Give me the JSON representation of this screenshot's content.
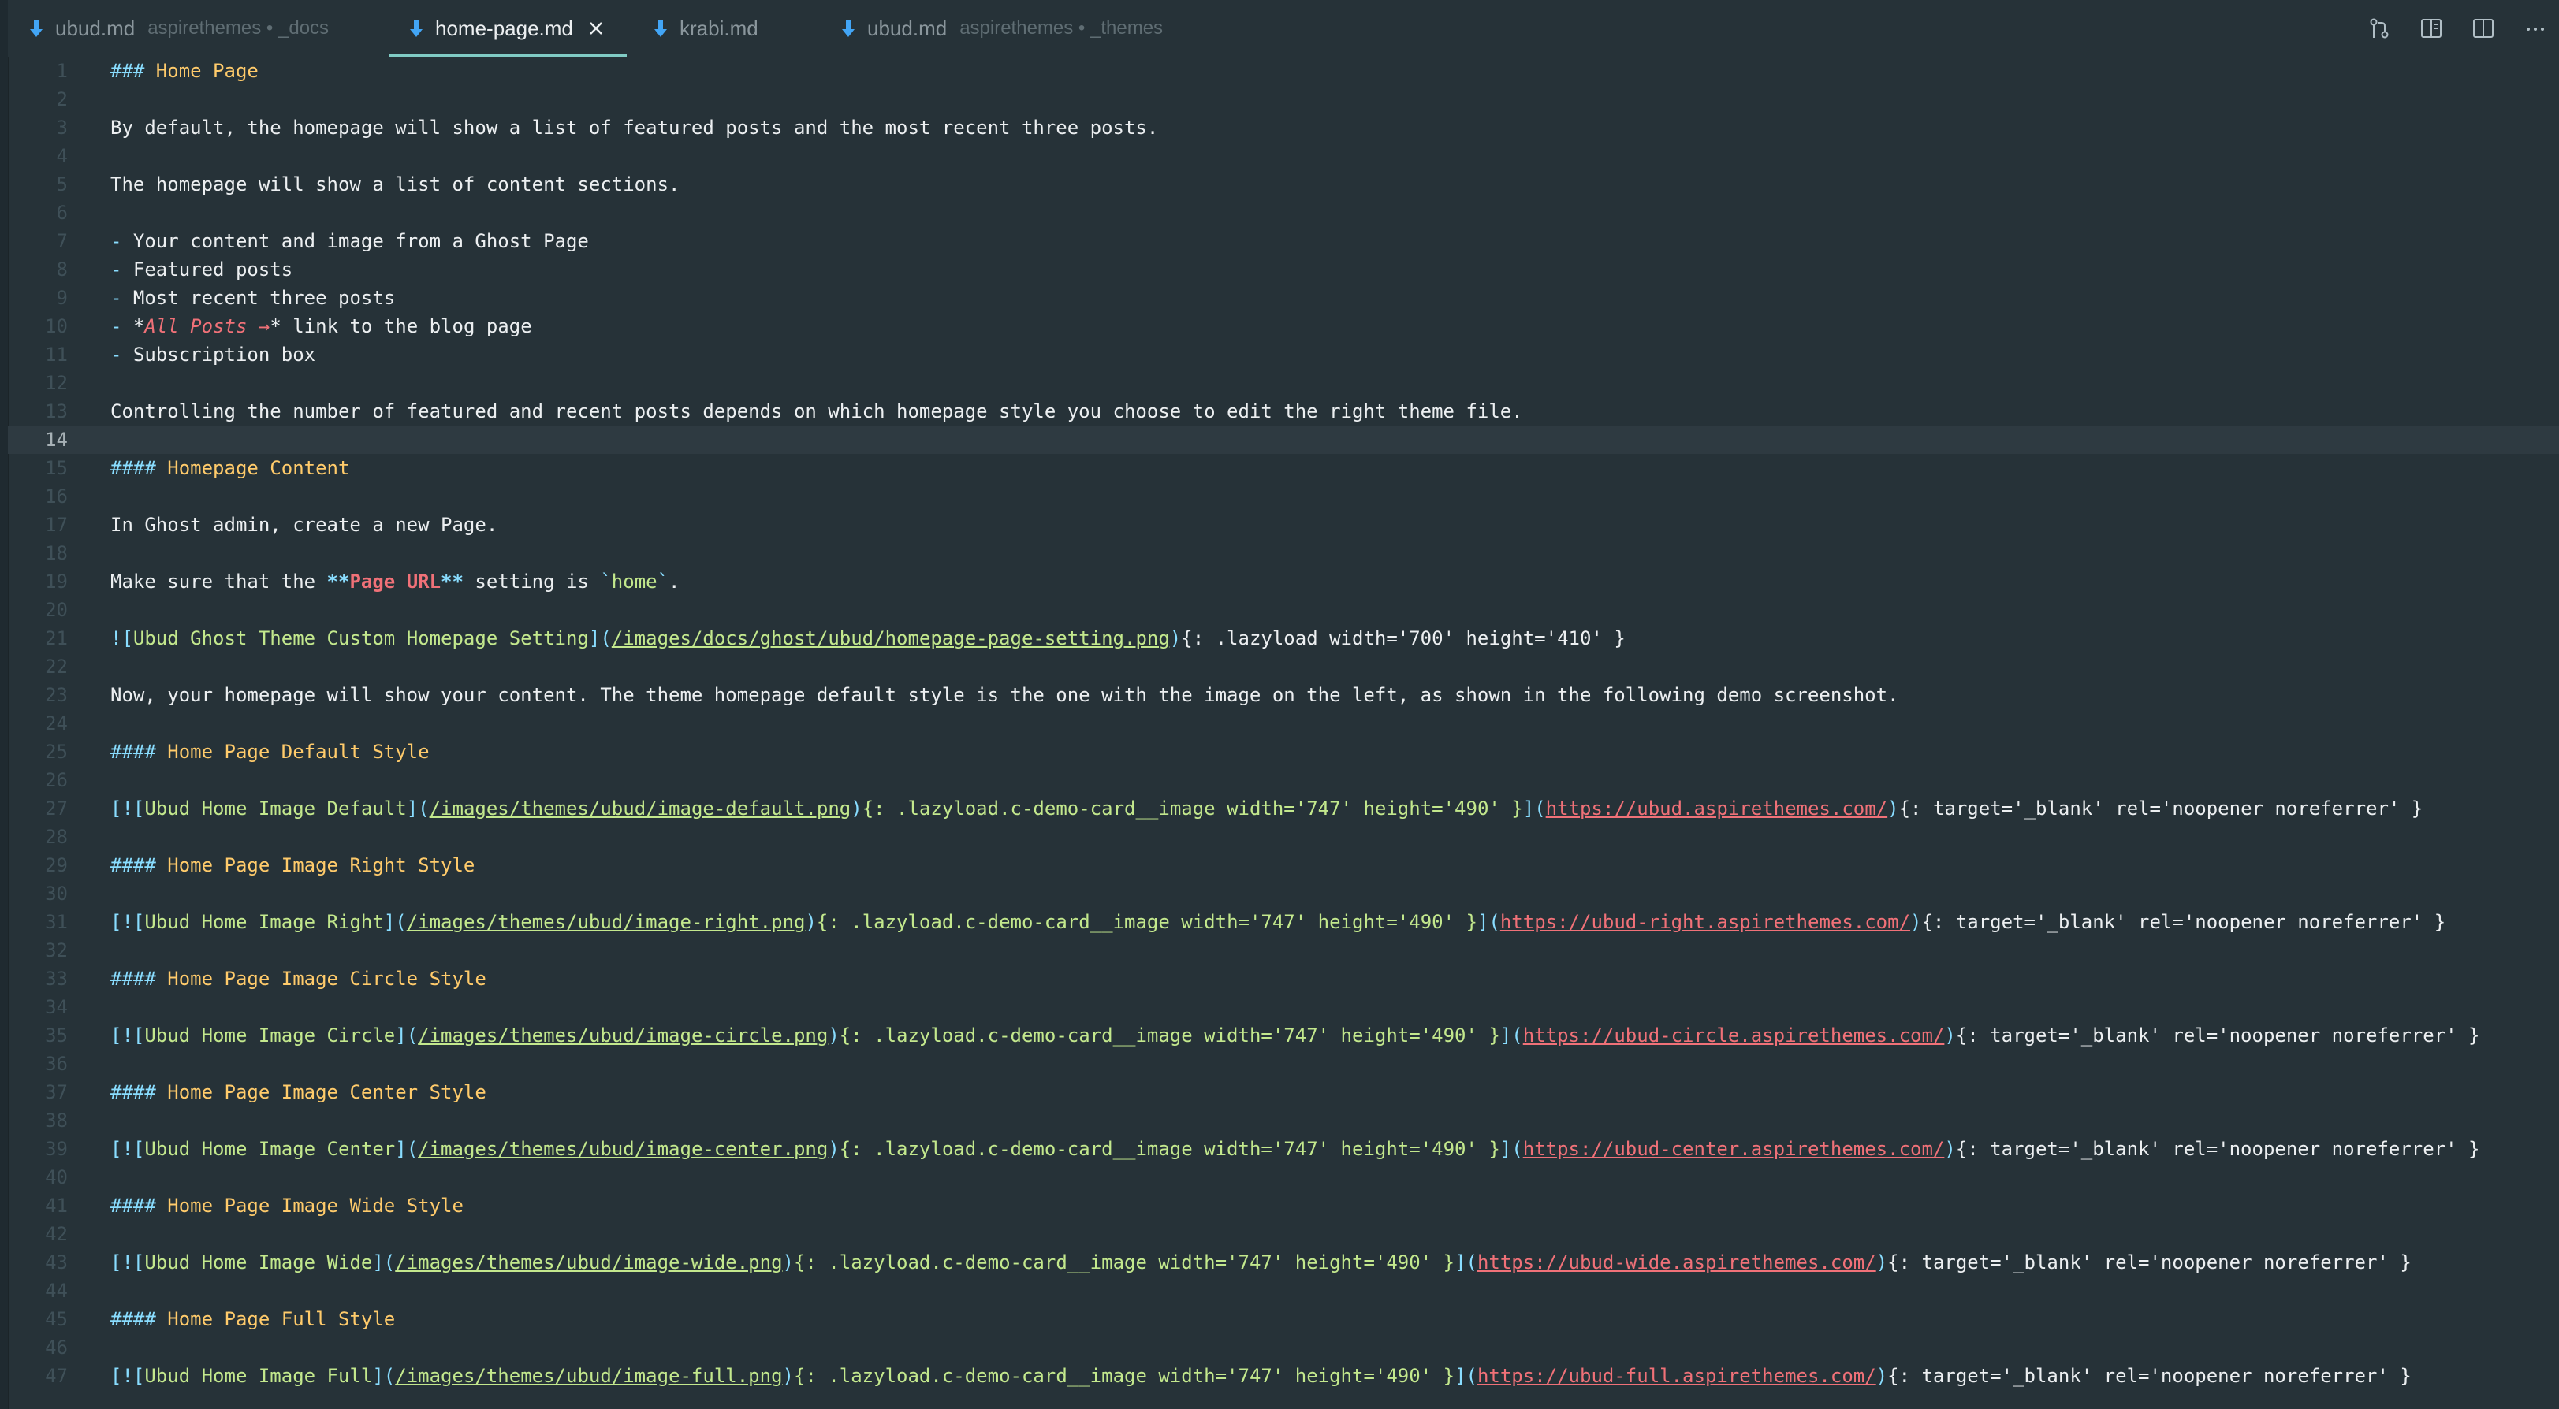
{
  "tabs": [
    {
      "icon": "markdown-file-icon",
      "name": "ubud.md",
      "description": "aspirethemes • _docs",
      "active": false
    },
    {
      "icon": "markdown-file-icon",
      "name": "home-page.md",
      "description": "",
      "active": true
    },
    {
      "icon": "markdown-file-icon",
      "name": "krabi.md",
      "description": "",
      "active": false
    },
    {
      "icon": "markdown-file-icon",
      "name": "ubud.md",
      "description": "aspirethemes • _themes",
      "active": false
    }
  ],
  "toolbar_icons": [
    "source-control-icon",
    "open-preview-icon",
    "split-editor-icon",
    "more-actions-icon"
  ],
  "editor": {
    "current_line": 14,
    "lines": [
      {
        "n": "1",
        "parts": [
          [
            "hm",
            "### "
          ],
          [
            "h",
            "Home Page"
          ]
        ]
      },
      {
        "n": "2",
        "parts": []
      },
      {
        "n": "3",
        "parts": [
          [
            "t",
            "By default, the homepage will show a list of featured posts and the most recent three posts."
          ]
        ]
      },
      {
        "n": "4",
        "parts": []
      },
      {
        "n": "5",
        "parts": [
          [
            "t",
            "The homepage will show a list of content sections."
          ]
        ]
      },
      {
        "n": "6",
        "parts": []
      },
      {
        "n": "7",
        "parts": [
          [
            "pl",
            "- "
          ],
          [
            "t",
            "Your content and image from a Ghost Page"
          ]
        ]
      },
      {
        "n": "8",
        "parts": [
          [
            "pl",
            "- "
          ],
          [
            "t",
            "Featured posts"
          ]
        ]
      },
      {
        "n": "9",
        "parts": [
          [
            "pl",
            "- "
          ],
          [
            "t",
            "Most recent three posts"
          ]
        ]
      },
      {
        "n": "10",
        "parts": [
          [
            "pl",
            "- "
          ],
          [
            "t",
            "*"
          ],
          [
            "em",
            "All Posts →"
          ],
          [
            "t",
            "*"
          ],
          [
            "t",
            " link to the blog page"
          ]
        ]
      },
      {
        "n": "11",
        "parts": [
          [
            "pl",
            "- "
          ],
          [
            "t",
            "Subscription box"
          ]
        ]
      },
      {
        "n": "12",
        "parts": []
      },
      {
        "n": "13",
        "parts": [
          [
            "t",
            "Controlling the number of featured and recent posts depends on which homepage style you choose to edit the right theme file."
          ]
        ]
      },
      {
        "n": "14",
        "parts": []
      },
      {
        "n": "15",
        "parts": [
          [
            "hm",
            "#### "
          ],
          [
            "h",
            "Homepage Content"
          ]
        ]
      },
      {
        "n": "16",
        "parts": []
      },
      {
        "n": "17",
        "parts": [
          [
            "t",
            "In Ghost admin, create a new Page."
          ]
        ]
      },
      {
        "n": "18",
        "parts": []
      },
      {
        "n": "19",
        "parts": [
          [
            "t",
            "Make sure that the "
          ],
          [
            "stm",
            "**"
          ],
          [
            "st",
            "Page URL"
          ],
          [
            "stm",
            "**"
          ],
          [
            "t",
            " setting is "
          ],
          [
            "cdm",
            "`"
          ],
          [
            "cd",
            "home"
          ],
          [
            "cdm",
            "`"
          ],
          [
            "t",
            "."
          ]
        ]
      },
      {
        "n": "20",
        "parts": []
      },
      {
        "n": "21",
        "parts": [
          [
            "punc",
            "!["
          ],
          [
            "alt",
            "Ubud Ghost Theme Custom Homepage Setting"
          ],
          [
            "punc",
            "]("
          ],
          [
            "path",
            "/images/docs/ghost/ubud/homepage-page-setting.png"
          ],
          [
            "punc",
            ")"
          ],
          [
            "attrw",
            "{: .lazyload width='700' height='410' }"
          ]
        ]
      },
      {
        "n": "22",
        "parts": []
      },
      {
        "n": "23",
        "parts": [
          [
            "t",
            "Now, your homepage will show your content. The theme homepage default style is the one with the image on the left, as shown in the following demo screenshot."
          ]
        ]
      },
      {
        "n": "24",
        "parts": []
      },
      {
        "n": "25",
        "parts": [
          [
            "hm",
            "#### "
          ],
          [
            "h",
            "Home Page Default Style"
          ]
        ]
      },
      {
        "n": "26",
        "parts": []
      },
      {
        "n": "27",
        "parts": [
          [
            "punc",
            "[!["
          ],
          [
            "alt",
            "Ubud Home Image Default"
          ],
          [
            "punc",
            "]("
          ],
          [
            "path",
            "/images/themes/ubud/image-default.png"
          ],
          [
            "punc",
            ")"
          ],
          [
            "attr",
            "{: .lazyload.c-demo-card__image width='747' height='490' }"
          ],
          [
            "punc",
            "]("
          ],
          [
            "url",
            "https://ubud.aspirethemes.com/"
          ],
          [
            "punc",
            ")"
          ],
          [
            "attrw",
            "{: target='_blank' rel='noopener noreferrer' }"
          ]
        ]
      },
      {
        "n": "28",
        "parts": []
      },
      {
        "n": "29",
        "parts": [
          [
            "hm",
            "#### "
          ],
          [
            "h",
            "Home Page Image Right Style"
          ]
        ]
      },
      {
        "n": "30",
        "parts": []
      },
      {
        "n": "31",
        "parts": [
          [
            "punc",
            "[!["
          ],
          [
            "alt",
            "Ubud Home Image Right"
          ],
          [
            "punc",
            "]("
          ],
          [
            "path",
            "/images/themes/ubud/image-right.png"
          ],
          [
            "punc",
            ")"
          ],
          [
            "attr",
            "{: .lazyload.c-demo-card__image width='747' height='490' }"
          ],
          [
            "punc",
            "]("
          ],
          [
            "url",
            "https://ubud-right.aspirethemes.com/"
          ],
          [
            "punc",
            ")"
          ],
          [
            "attrw",
            "{: target='_blank' rel='noopener noreferrer' }"
          ]
        ]
      },
      {
        "n": "32",
        "parts": []
      },
      {
        "n": "33",
        "parts": [
          [
            "hm",
            "#### "
          ],
          [
            "h",
            "Home Page Image Circle Style"
          ]
        ]
      },
      {
        "n": "34",
        "parts": []
      },
      {
        "n": "35",
        "parts": [
          [
            "punc",
            "[!["
          ],
          [
            "alt",
            "Ubud Home Image Circle"
          ],
          [
            "punc",
            "]("
          ],
          [
            "path",
            "/images/themes/ubud/image-circle.png"
          ],
          [
            "punc",
            ")"
          ],
          [
            "attr",
            "{: .lazyload.c-demo-card__image width='747' height='490' }"
          ],
          [
            "punc",
            "]("
          ],
          [
            "url",
            "https://ubud-circle.aspirethemes.com/"
          ],
          [
            "punc",
            ")"
          ],
          [
            "attrw",
            "{: target='_blank' rel='noopener noreferrer' }"
          ]
        ]
      },
      {
        "n": "36",
        "parts": []
      },
      {
        "n": "37",
        "parts": [
          [
            "hm",
            "#### "
          ],
          [
            "h",
            "Home Page Image Center Style"
          ]
        ]
      },
      {
        "n": "38",
        "parts": []
      },
      {
        "n": "39",
        "parts": [
          [
            "punc",
            "[!["
          ],
          [
            "alt",
            "Ubud Home Image Center"
          ],
          [
            "punc",
            "]("
          ],
          [
            "path",
            "/images/themes/ubud/image-center.png"
          ],
          [
            "punc",
            ")"
          ],
          [
            "attr",
            "{: .lazyload.c-demo-card__image width='747' height='490' }"
          ],
          [
            "punc",
            "]("
          ],
          [
            "url",
            "https://ubud-center.aspirethemes.com/"
          ],
          [
            "punc",
            ")"
          ],
          [
            "attrw",
            "{: target='_blank' rel='noopener noreferrer' }"
          ]
        ]
      },
      {
        "n": "40",
        "parts": []
      },
      {
        "n": "41",
        "parts": [
          [
            "hm",
            "#### "
          ],
          [
            "h",
            "Home Page Image Wide Style"
          ]
        ]
      },
      {
        "n": "42",
        "parts": []
      },
      {
        "n": "43",
        "parts": [
          [
            "punc",
            "[!["
          ],
          [
            "alt",
            "Ubud Home Image Wide"
          ],
          [
            "punc",
            "]("
          ],
          [
            "path",
            "/images/themes/ubud/image-wide.png"
          ],
          [
            "punc",
            ")"
          ],
          [
            "attr",
            "{: .lazyload.c-demo-card__image width='747' height='490' }"
          ],
          [
            "punc",
            "]("
          ],
          [
            "url",
            "https://ubud-wide.aspirethemes.com/"
          ],
          [
            "punc",
            ")"
          ],
          [
            "attrw",
            "{: target='_blank' rel='noopener noreferrer' }"
          ]
        ]
      },
      {
        "n": "44",
        "parts": []
      },
      {
        "n": "45",
        "parts": [
          [
            "hm",
            "#### "
          ],
          [
            "h",
            "Home Page Full Style"
          ]
        ]
      },
      {
        "n": "46",
        "parts": []
      },
      {
        "n": "47",
        "parts": [
          [
            "punc",
            "[!["
          ],
          [
            "alt",
            "Ubud Home Image Full"
          ],
          [
            "punc",
            "]("
          ],
          [
            "path",
            "/images/themes/ubud/image-full.png"
          ],
          [
            "punc",
            ")"
          ],
          [
            "attr",
            "{: .lazyload.c-demo-card__image width='747' height='490' }"
          ],
          [
            "punc",
            "]("
          ],
          [
            "url",
            "https://ubud-full.aspirethemes.com/"
          ],
          [
            "punc",
            ")"
          ],
          [
            "attrw",
            "{: target='_blank' rel='noopener noreferrer' }"
          ]
        ]
      }
    ]
  }
}
